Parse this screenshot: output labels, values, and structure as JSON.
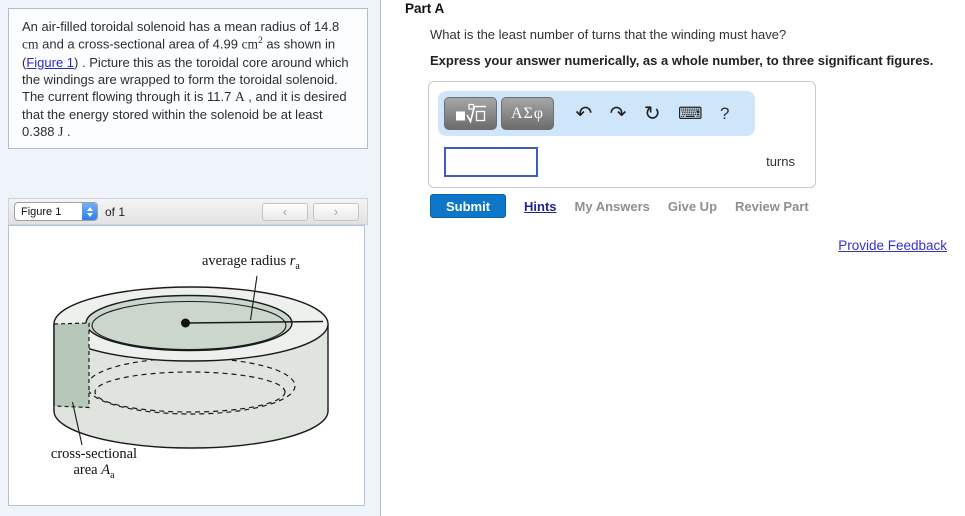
{
  "colors": {
    "panel_bg": "#eef4fa",
    "submit_blue": "#0d76c8",
    "toolbar_blue": "#cfe5f9",
    "input_border_blue": "#3a5cc4",
    "link_blue": "#2a2ac0",
    "feedback_link_blue": "#3333cc",
    "hints_navy": "#23258e"
  },
  "left_panel": {
    "problem": {
      "s1": "An air-filled toroidal solenoid has a mean radius of 14.8 ",
      "u1": "cm",
      "s2": " and a cross-sectional area of 4.99 ",
      "u2": "cm",
      "u2_sup": "2",
      "s3": " as shown in (",
      "link": "Figure 1",
      "s4": ") . Picture this as the toroidal core around which the windings are wrapped to form the toroidal solenoid. The current flowing through it is 11.7 ",
      "u3": "A",
      "s5": " , and it is desired that the energy stored within the solenoid be at least 0.388 ",
      "u4": "J",
      "s6": " ."
    },
    "figure_bar": {
      "select_value": "Figure 1",
      "of_label": "of 1",
      "prev_icon": "‹",
      "next_icon": "›"
    },
    "figure_labels": {
      "radius_prefix": "average radius ",
      "radius_var": "r",
      "radius_sub": "a",
      "area_line1": "cross-sectional",
      "area_prefix": "area ",
      "area_var": "A",
      "area_sub": "a"
    }
  },
  "main": {
    "part_title": "Part A",
    "question": "What is the least number of turns that the winding must have?",
    "instruction": "Express your answer numerically, as a whole number, to three significant figures.",
    "toolbar": {
      "greek_label": "ΑΣφ",
      "undo_icon": "↶",
      "redo_icon": "↷",
      "reset_icon": "↻",
      "keyboard_icon": "⌨",
      "help_icon": "?"
    },
    "answer": {
      "value": "",
      "unit": "turns"
    },
    "actions": {
      "submit": "Submit",
      "hints": "Hints",
      "my_answers": "My Answers",
      "give_up": "Give Up",
      "review_part": "Review Part"
    },
    "feedback_link": "Provide Feedback"
  }
}
